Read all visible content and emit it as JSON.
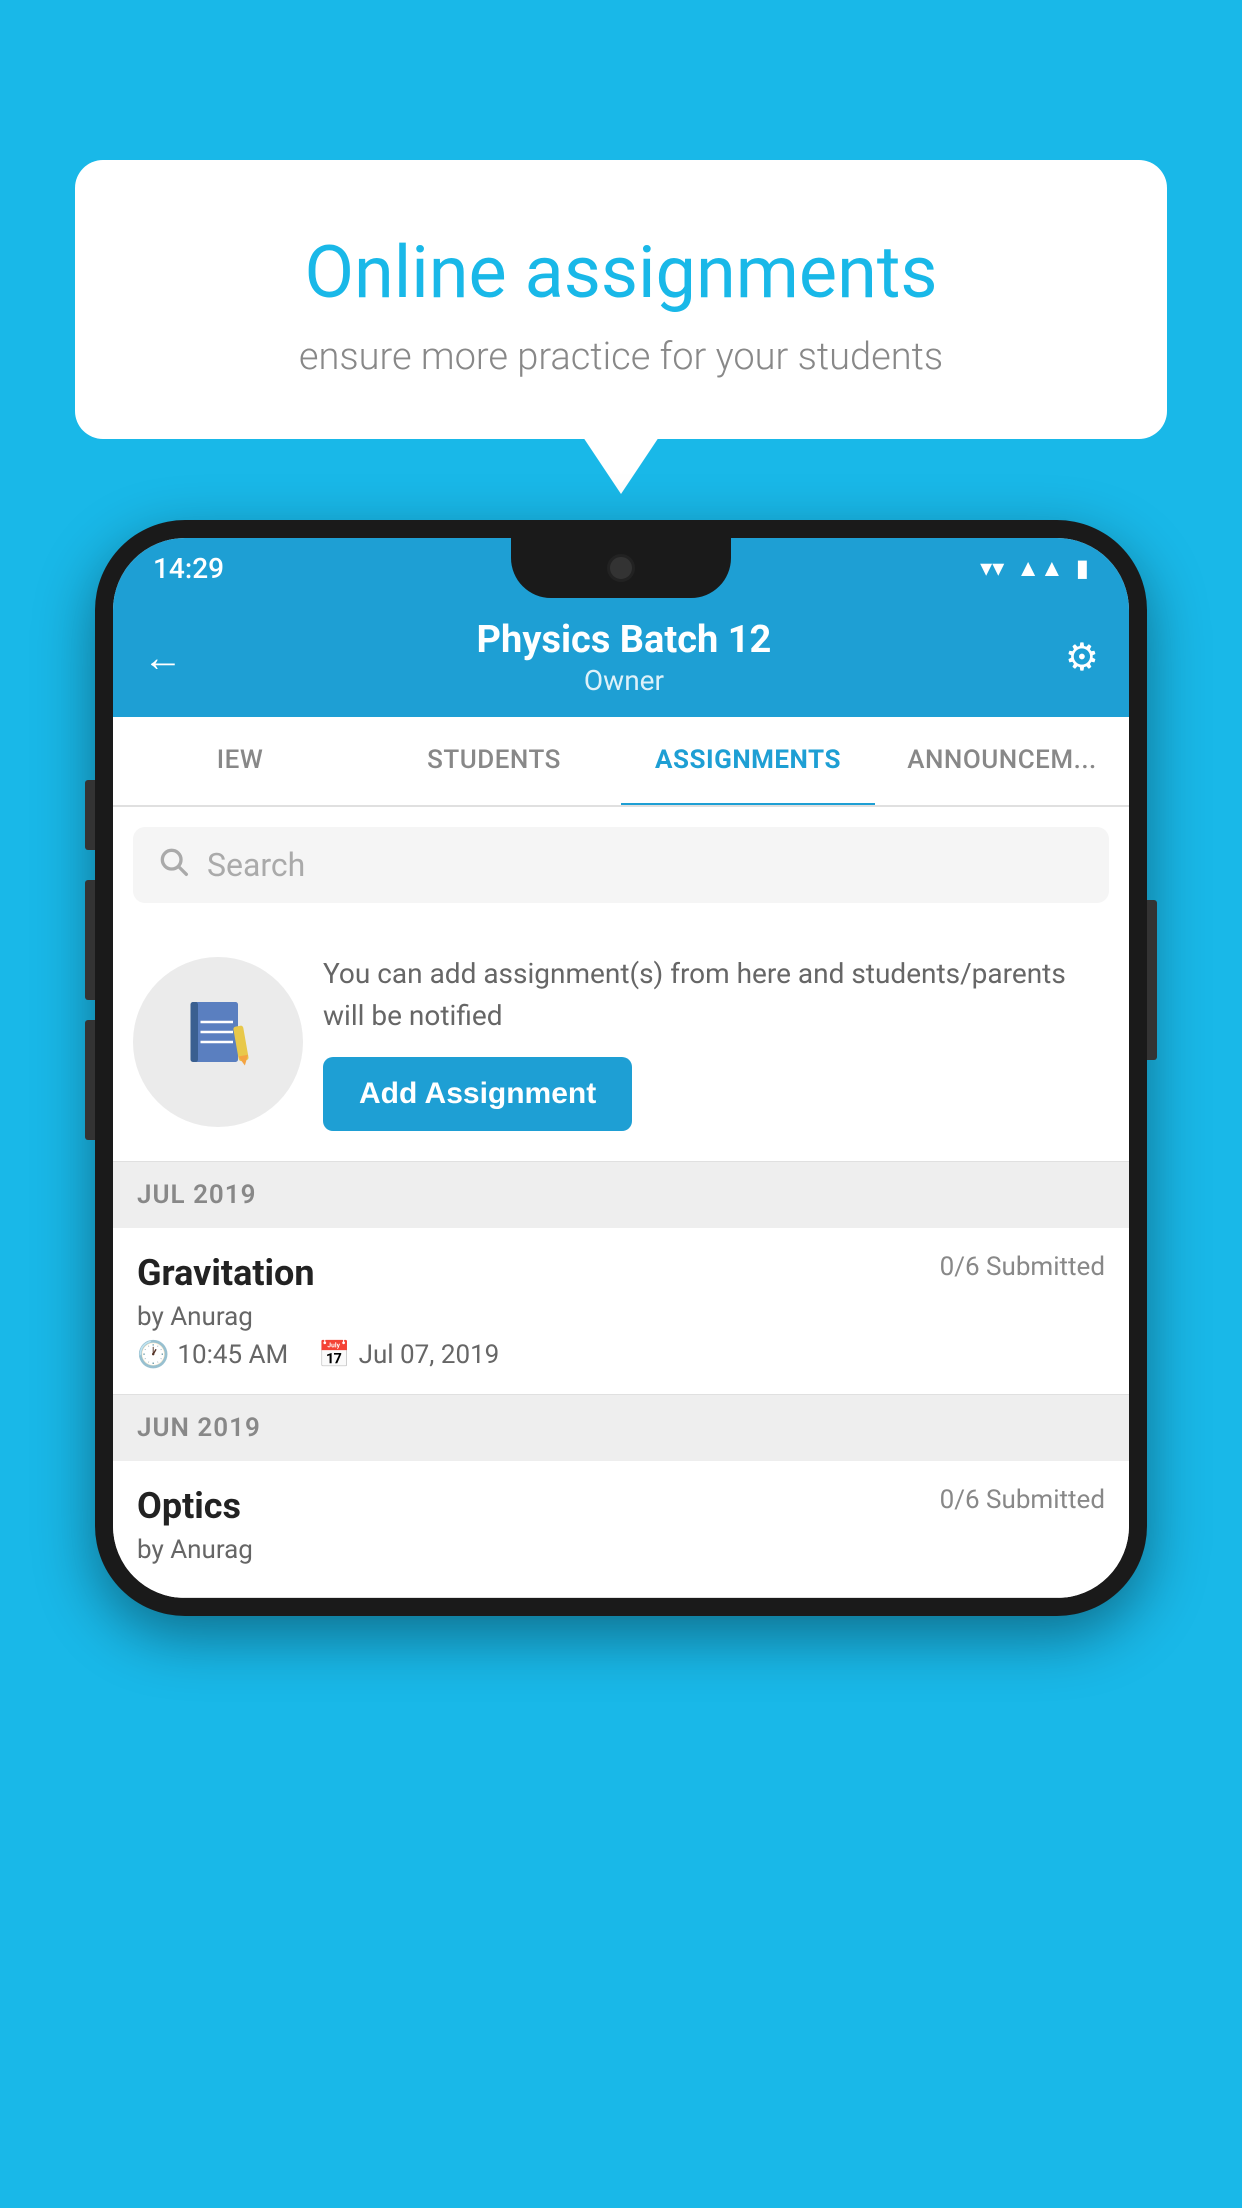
{
  "background_color": "#19b8e8",
  "speech_bubble": {
    "title": "Online assignments",
    "subtitle": "ensure more practice for your students"
  },
  "phone": {
    "status_bar": {
      "time": "14:29",
      "icons": [
        "wifi",
        "signal",
        "battery"
      ]
    },
    "header": {
      "title": "Physics Batch 12",
      "subtitle": "Owner",
      "back_label": "←",
      "settings_label": "⚙"
    },
    "tabs": [
      {
        "label": "IEW",
        "active": false
      },
      {
        "label": "STUDENTS",
        "active": false
      },
      {
        "label": "ASSIGNMENTS",
        "active": true
      },
      {
        "label": "ANNOUNCEM...",
        "active": false
      }
    ],
    "search": {
      "placeholder": "Search"
    },
    "promo": {
      "text": "You can add assignment(s) from here and students/parents will be notified",
      "button_label": "Add Assignment"
    },
    "sections": [
      {
        "month": "JUL 2019",
        "assignments": [
          {
            "name": "Gravitation",
            "submitted": "0/6 Submitted",
            "by": "by Anurag",
            "time": "10:45 AM",
            "date": "Jul 07, 2019"
          }
        ]
      },
      {
        "month": "JUN 2019",
        "assignments": [
          {
            "name": "Optics",
            "submitted": "0/6 Submitted",
            "by": "by Anurag",
            "time": "",
            "date": ""
          }
        ]
      }
    ]
  }
}
